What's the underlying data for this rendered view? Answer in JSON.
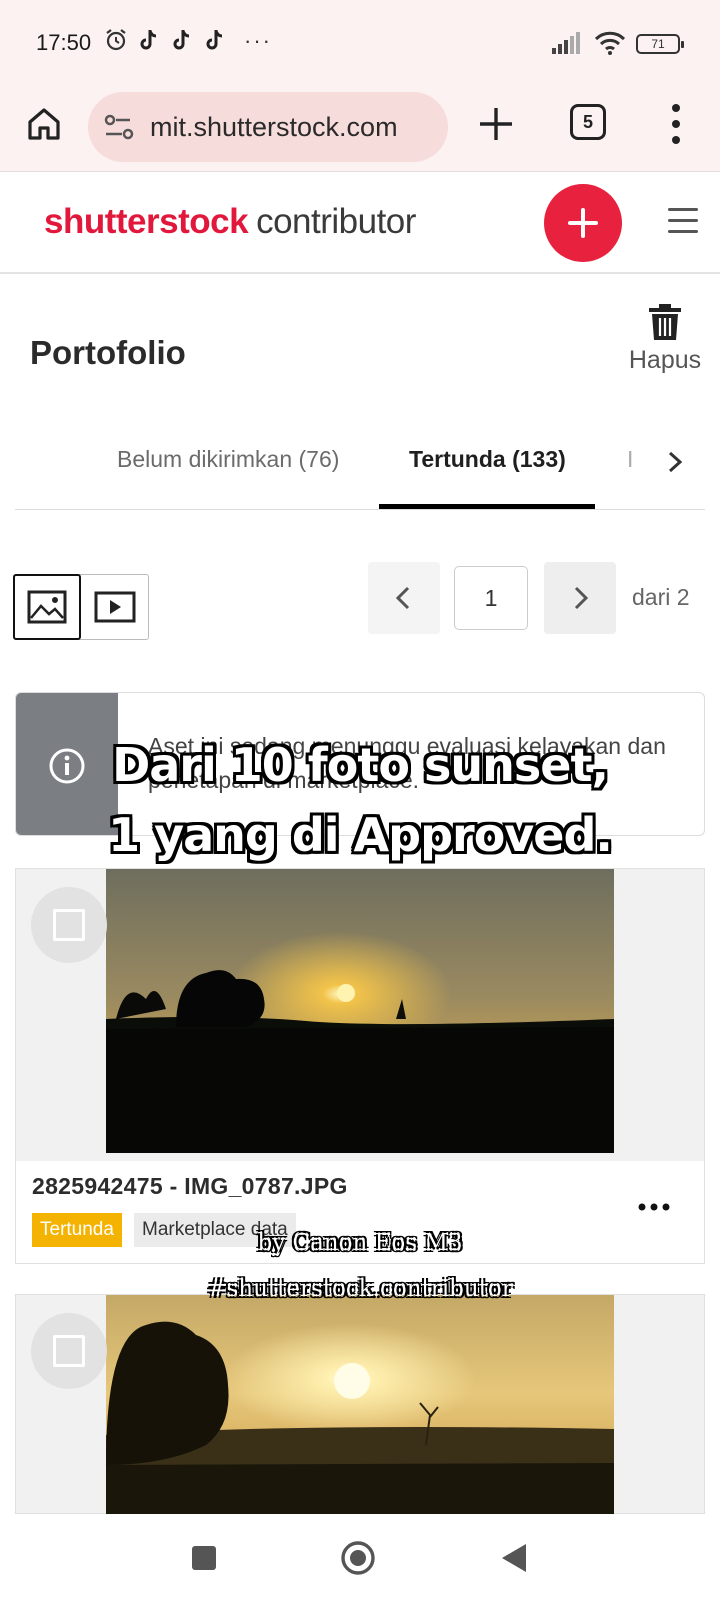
{
  "status_bar": {
    "time": "17:50",
    "battery": "71",
    "more": "···"
  },
  "browser": {
    "url": "mit.shutterstock.com",
    "tab_count": "5"
  },
  "header": {
    "logo_brand": "shutterstock",
    "logo_sub": "contributor"
  },
  "page": {
    "title": "Portofolio",
    "delete_label": "Hapus"
  },
  "tabs": [
    {
      "label": "Belum dikirimkan (76)",
      "active": false
    },
    {
      "label": "Tertunda (133)",
      "active": true
    },
    {
      "label": "I",
      "active": false
    }
  ],
  "pager": {
    "current": "1",
    "total_label": "dari 2"
  },
  "info": {
    "message": "Aset ini sedang menunggu evaluasi kelayakan dan penetapan di marketplace."
  },
  "overlay": {
    "caption_line1": "Dari 10 foto sunset,",
    "caption_line2": "1 yang di Approved.",
    "watermark_line1": "by Canon Eos M3",
    "watermark_line2": "#shutterstock.contributor"
  },
  "assets": [
    {
      "filename": "2825942475 - IMG_0787.JPG",
      "status": "Tertunda",
      "tag": "Marketplace data"
    }
  ],
  "colors": {
    "brand": "#e1183c",
    "pending_badge": "#f3b300",
    "info_bar": "#7b7f83",
    "browser_bg": "#fbf2f1"
  }
}
